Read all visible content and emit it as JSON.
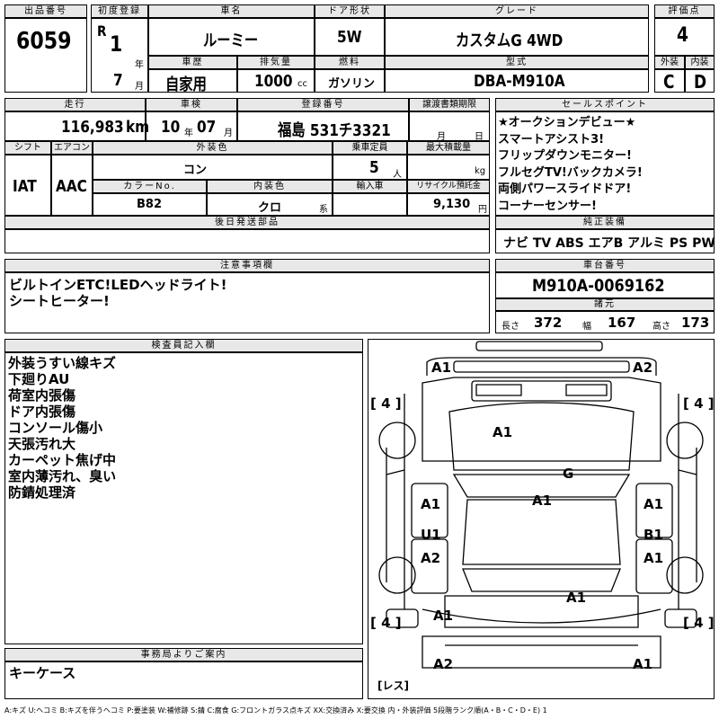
{
  "header": {
    "lot_label": "出品番号",
    "lot_number": "6059",
    "first_reg_label": "初度登録",
    "era": "R",
    "year_num": "1",
    "year_unit": "年",
    "month_num": "7",
    "month_unit": "月",
    "car_name_label": "車名",
    "car_name": "ルーミー",
    "door_label": "ドア形状",
    "door": "5W",
    "grade_label": "グレード",
    "grade": "カスタムG 4WD",
    "score_label": "評価点",
    "score": "4",
    "history_label": "車歴",
    "history": "自家用",
    "displacement_label": "排気量",
    "displacement": "1000",
    "displacement_unit": "cc",
    "fuel_label": "燃料",
    "fuel": "ガソリン",
    "model_label": "型式",
    "model": "DBA-M910A",
    "exterior_label": "外装",
    "exterior": "C",
    "interior_label": "内装",
    "interior": "D"
  },
  "row2": {
    "mileage_label": "走行",
    "mileage": "116,983",
    "mileage_unit": "km",
    "inspection_label": "車検",
    "insp_year": "10",
    "insp_year_unit": "年",
    "insp_month": "07",
    "insp_month_unit": "月",
    "reg_label": "登録番号",
    "reg_number": "福島 531チ3321",
    "transfer_label": "譲渡書類期限",
    "transfer_month": "月",
    "transfer_day": "日",
    "shift_label": "シフト",
    "shift": "IAT",
    "ac_label": "エアコン",
    "ac": "AAC",
    "color_label": "外装色",
    "color": "コン",
    "capacity_label": "乗車定員",
    "capacity": "5",
    "capacity_unit": "人",
    "load_label": "最大積載量",
    "load_unit": "kg",
    "color_no_label": "カラーNo.",
    "color_no": "B82",
    "int_color_label": "内装色",
    "int_color": "クロ",
    "int_color_unit": "系",
    "import_label": "輸入車",
    "recycle_label": "リサイクル預託金",
    "recycle": "9,130",
    "recycle_unit": "円",
    "later_label": "後日発送部品"
  },
  "sales": {
    "label": "セールスポイント",
    "lines": [
      "★オークションデビュー★",
      "スマートアシスト3!",
      "フリップダウンモニター!",
      "フルセグTV!バックカメラ!",
      "両側パワースライドドア!",
      "コーナーセンサー!"
    ]
  },
  "equipment": {
    "label": "純正装備",
    "items": "ナビ TV ABS エアB アルミ PS PW"
  },
  "caution": {
    "label": "注意事項欄",
    "lines": [
      "ビルトインETC!LEDヘッドライト!",
      "シートヒーター!"
    ]
  },
  "chassis": {
    "label": "車台番号",
    "number": "M910A-0069162",
    "spec_label": "諸元",
    "length_label": "長さ",
    "length": "372",
    "width_label": "幅",
    "width": "167",
    "height_label": "高さ",
    "height": "173"
  },
  "inspector": {
    "label": "検査員記入欄",
    "lines": [
      "外装うすい線キズ",
      "下廻りAU",
      "荷室内張傷",
      "ドア内張傷",
      "コンソール傷小",
      "天張汚れ大",
      "カーペット焦げ中",
      "室内薄汚れ、臭い",
      "防錆処理済"
    ]
  },
  "office": {
    "label": "事務局よりご案内",
    "text": "キーケース"
  },
  "diagram": {
    "marks": {
      "front_left": "A1",
      "front_right": "A2",
      "hood": "A1",
      "windshield": "G",
      "roof": "A1",
      "left_front_door": "A1",
      "right_front_door": "A1",
      "left_rear_door": "U1",
      "right_rear_door": "B1",
      "left_rear_door_low": "A2",
      "right_rear_door_low": "A1",
      "back_door": "A1",
      "rear_left_quarter": "A1",
      "rear_bumper_left": "A2",
      "rear_bumper_right": "A1"
    },
    "tires": [
      "4",
      "4",
      "4",
      "4"
    ],
    "spare": "レス"
  },
  "legend": "A:キズ U:ヘコミ B:キズを伴うヘコミ P:要塗装 W:補修跡 S:錆 C:腐食 G:フロントガラス点キズ XX:交換済み X:要交換 内・外装評価 5段階ランク順(A・B・C・D・E) 1"
}
